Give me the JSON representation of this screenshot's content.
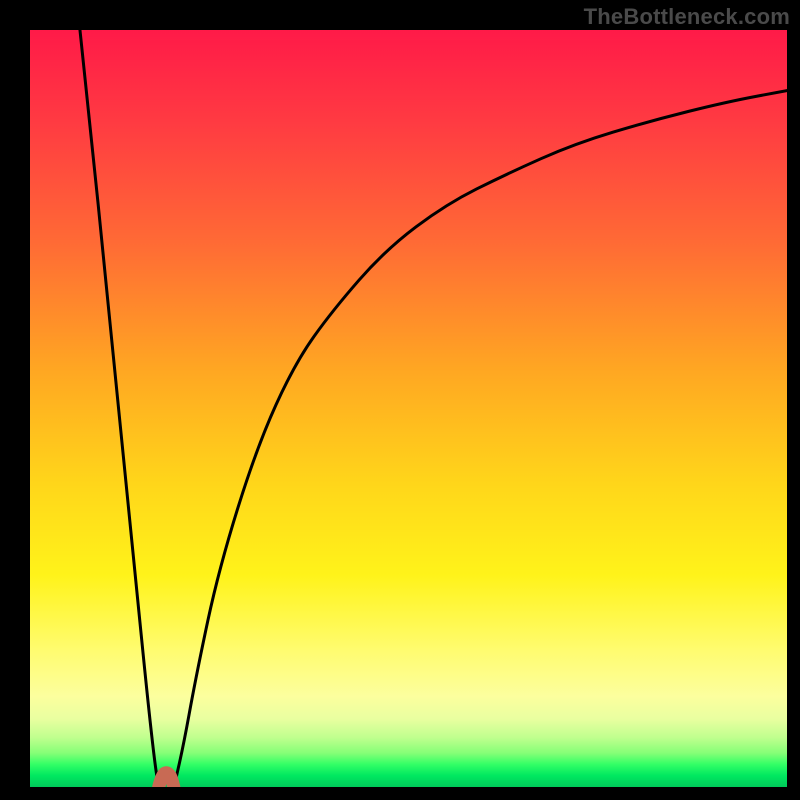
{
  "attribution": "TheBottleneck.com",
  "chart_data": {
    "type": "line",
    "title": "",
    "xlabel": "",
    "ylabel": "",
    "xlim": [
      0,
      100
    ],
    "ylim": [
      0,
      100
    ],
    "grid": false,
    "legend": false,
    "notch_x": 17,
    "notch_value": 0,
    "series": [
      {
        "name": "left-branch",
        "x": [
          6.6,
          8,
          10,
          12,
          14,
          15.5,
          16.5,
          17
        ],
        "values": [
          100,
          87,
          67,
          47,
          27,
          12,
          3,
          0
        ]
      },
      {
        "name": "notch",
        "x": [
          17,
          17.4,
          18,
          18.6,
          19
        ],
        "values": [
          0,
          1.5,
          2,
          1.5,
          0
        ]
      },
      {
        "name": "right-branch",
        "x": [
          19,
          20,
          22,
          25,
          30,
          35,
          40,
          47,
          55,
          63,
          72,
          82,
          92,
          100
        ],
        "values": [
          0,
          4,
          15,
          29,
          45,
          56,
          63,
          71,
          77,
          81,
          85,
          88,
          90.5,
          92
        ]
      }
    ],
    "background_gradient_stops": [
      {
        "pos": 0,
        "color": "#ff1a48"
      },
      {
        "pos": 12,
        "color": "#ff3a42"
      },
      {
        "pos": 28,
        "color": "#ff6a35"
      },
      {
        "pos": 45,
        "color": "#ffa722"
      },
      {
        "pos": 60,
        "color": "#ffd61a"
      },
      {
        "pos": 72,
        "color": "#fff31a"
      },
      {
        "pos": 82,
        "color": "#fffc70"
      },
      {
        "pos": 88,
        "color": "#fcff9e"
      },
      {
        "pos": 91,
        "color": "#e9ffa0"
      },
      {
        "pos": 93.5,
        "color": "#bfff8e"
      },
      {
        "pos": 95.5,
        "color": "#86ff77"
      },
      {
        "pos": 97,
        "color": "#33ff66"
      },
      {
        "pos": 98.5,
        "color": "#00e860"
      },
      {
        "pos": 100,
        "color": "#00c95a"
      }
    ],
    "notch_marker_color": "#c86a54"
  }
}
